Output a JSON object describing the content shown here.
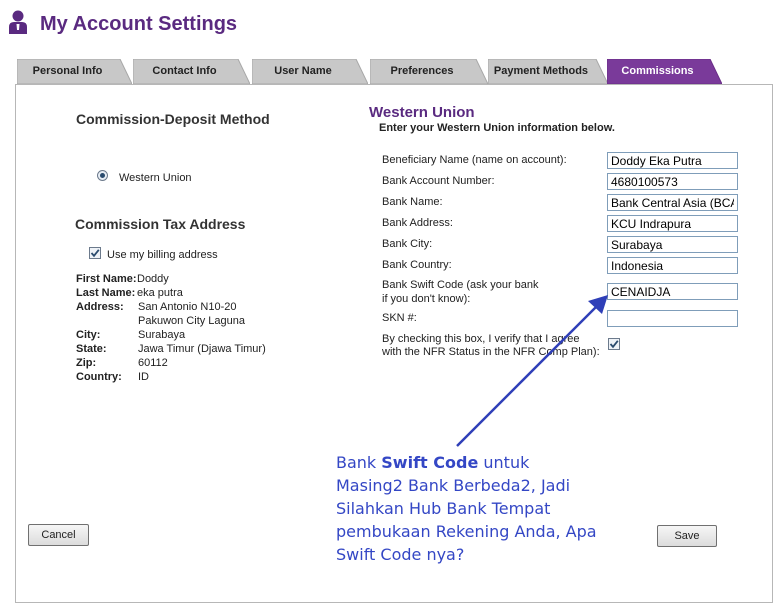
{
  "header": {
    "title": "My Account Settings",
    "icon": "user-icon",
    "accent": "#5a2a80"
  },
  "tabs": [
    {
      "label": "Personal Info",
      "active": false
    },
    {
      "label": "Contact Info",
      "active": false
    },
    {
      "label": "User Name",
      "active": false
    },
    {
      "label": "Preferences",
      "active": false
    },
    {
      "label": "Payment Methods",
      "active": false
    },
    {
      "label": "Commissions",
      "active": true
    }
  ],
  "commission": {
    "method_title": "Commission-Deposit Method",
    "method_option": "Western Union",
    "method_selected": true,
    "tax_title": "Commission Tax Address",
    "use_billing_label": "Use my billing address",
    "use_billing_checked": true,
    "address": {
      "first_name_label": "First Name:",
      "first_name": "Doddy",
      "last_name_label": "Last Name:",
      "last_name": "eka putra",
      "address_label": "Address:",
      "address_line1": "San Antonio N10-20",
      "address_line2": "Pakuwon City Laguna",
      "city_label": "City:",
      "city": "Surabaya",
      "state_label": "State:",
      "state": "Jawa Timur (Djawa Timur)",
      "zip_label": "Zip:",
      "zip": "60112",
      "country_label": "Country:",
      "country": "ID"
    }
  },
  "western_union": {
    "title": "Western Union",
    "subtitle": "Enter your Western Union information below.",
    "fields": {
      "beneficiary_label": "Beneficiary Name (name on account):",
      "beneficiary": "Doddy Eka Putra",
      "account_label": "Bank Account Number:",
      "account": "4680100573",
      "bank_name_label": "Bank Name:",
      "bank_name": "Bank Central Asia (BCA)",
      "bank_address_label": "Bank Address:",
      "bank_address": "KCU Indrapura",
      "bank_city_label": "Bank City:",
      "bank_city": "Surabaya",
      "bank_country_label": "Bank Country:",
      "bank_country": "Indonesia",
      "swift_label_1": "Bank Swift Code (ask your bank",
      "swift_label_2": "if you don't know):",
      "swift": "CENAIDJA",
      "skn_label": "SKN #:",
      "skn": "",
      "verify_label_1": "By checking this box, I verify that I agree",
      "verify_label_2": "with the NFR Status in the NFR Comp Plan):",
      "verify_checked": true
    }
  },
  "buttons": {
    "cancel": "Cancel",
    "save": "Save"
  },
  "annotation": {
    "text_before": "Bank ",
    "text_bold": "Swift Code",
    "text_after": " untuk Masing2 Bank Berbeda2, Jadi Silahkan Hub Bank Tempat pembukaan Rekening Anda, Apa Swift Code nya?",
    "color": "#3447c5"
  }
}
